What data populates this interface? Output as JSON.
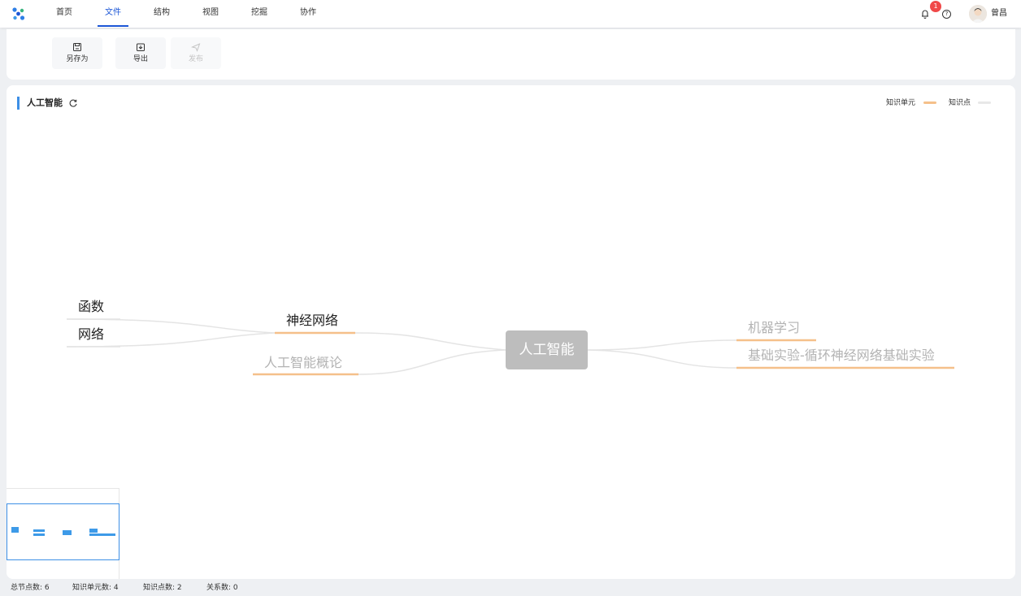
{
  "nav": {
    "items": [
      {
        "label": "首页"
      },
      {
        "label": "文件"
      },
      {
        "label": "结构"
      },
      {
        "label": "视图"
      },
      {
        "label": "挖掘"
      },
      {
        "label": "协作"
      }
    ],
    "active_index": 1
  },
  "header": {
    "notification_count": "1",
    "help_symbol": "?",
    "username": "曾昌"
  },
  "toolbar": {
    "save_as_label": "另存为",
    "export_label": "导出",
    "publish_label": "发布"
  },
  "map": {
    "title": "人工智能",
    "legend": {
      "unit_label": "知识单元",
      "point_label": "知识点"
    },
    "nodes": {
      "root": "人工智能",
      "left_1": "神经网络",
      "left_2": "人工智能概论",
      "left_1_child_1": "函数",
      "left_1_child_2": "网络",
      "right_1": "机器学习",
      "right_2": "基础实验-循环神经网络基础实验"
    }
  },
  "status": {
    "total_nodes": "总节点数: 6",
    "unit_count": "知识单元数: 4",
    "point_count": "知识点数: 2",
    "relation_count": "关系数: 0"
  },
  "colors": {
    "accent": "#1c56d6",
    "unit_line": "#f5c08a",
    "point_line": "#e8e8e8",
    "root_bg": "#bdbdbd",
    "minimap": "#3d9ae8"
  },
  "icons": [
    "app-logo-icon",
    "bell-icon",
    "help-icon",
    "save-as-icon",
    "export-icon",
    "publish-icon",
    "refresh-icon"
  ]
}
